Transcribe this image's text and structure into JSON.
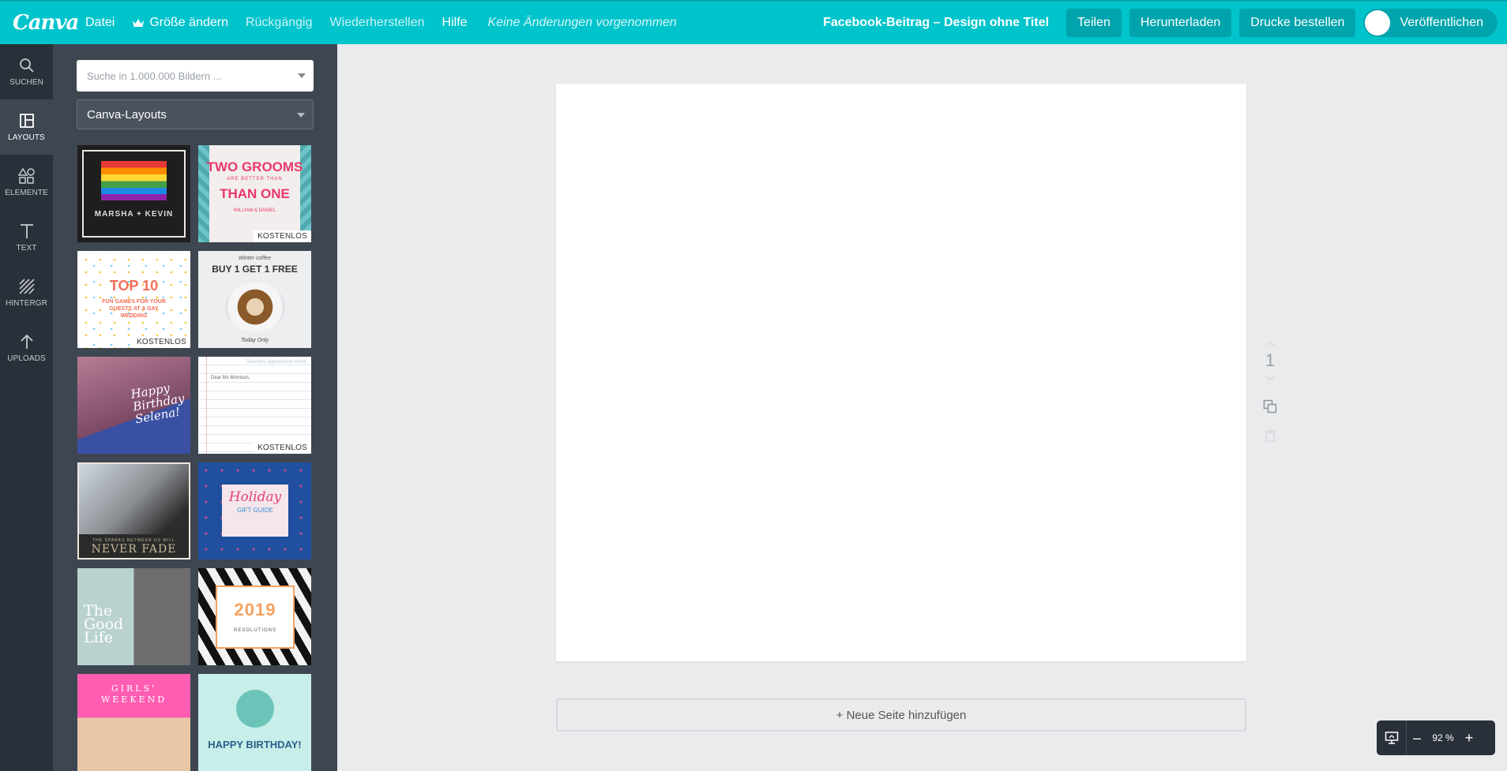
{
  "app": {
    "logo": "Canva"
  },
  "menu": {
    "file": "Datei",
    "resize": "Größe ändern",
    "undo": "Rückgängig",
    "redo": "Wiederherstellen",
    "help": "Hilfe",
    "status": "Keine Änderungen vorgenommen"
  },
  "header": {
    "title": "Facebook-Beitrag – Design ohne Titel",
    "share": "Teilen",
    "download": "Herunterladen",
    "print": "Drucke bestellen",
    "publish": "Veröffentlichen"
  },
  "rail": {
    "items": [
      {
        "label": "SUCHEN",
        "icon": "search-icon"
      },
      {
        "label": "LAYOUTS",
        "icon": "layout-icon"
      },
      {
        "label": "ELEMENTE",
        "icon": "shapes-icon"
      },
      {
        "label": "TEXT",
        "icon": "text-icon"
      },
      {
        "label": "HINTERGR",
        "icon": "background-icon"
      },
      {
        "label": "UPLOADS",
        "icon": "upload-icon"
      }
    ]
  },
  "panel": {
    "search_placeholder": "Suche in 1.000.000 Bildern ...",
    "filter_value": "Canva-Layouts",
    "badge": "KOSTENLOS"
  },
  "thumbs": {
    "t1": {
      "caption": "MARSHA + KEVIN"
    },
    "t2": {
      "line1": "TWO GROOMS",
      "line2": "ARE BETTER THAN",
      "line3": "THAN ONE",
      "line4": "WILLIAM & DANIEL"
    },
    "t3": {
      "line1": "TOP 10",
      "line2": "FUN GAMES FOR YOUR GUESTS AT A GAY WEDDING"
    },
    "t4": {
      "line0": "Winter coffee",
      "line1": "BUY 1 GET 1 FREE",
      "line2": "Today Only"
    },
    "t5": {
      "line1": "Happy",
      "line2": "Birthday",
      "line3": "Selena!"
    },
    "t6": {
      "line1": "Teachers Appreciation Week",
      "line2": "Dear Ms Morrison,"
    },
    "t7": {
      "line1": "THE SPARKS BETWEEN US WILL",
      "line2": "NEVER FADE"
    },
    "t8": {
      "line1": "Holiday",
      "line2": "GIFT GUIDE"
    },
    "t9": {
      "line1": "The",
      "line2": "Good",
      "line3": "Life"
    },
    "t10": {
      "line1": "2019",
      "line2": "RESOLUTIONS"
    },
    "t11": {
      "line1": "GIRLS'",
      "line2": "WEEKEND"
    },
    "t12": {
      "line1": "HAPPY BIRTHDAY!"
    }
  },
  "canvas": {
    "page_number": "1",
    "add_page": "+ Neue Seite hinzufügen"
  },
  "zoom": {
    "minus": "–",
    "value": "92 %",
    "plus": "+"
  },
  "colors": {
    "brand": "#00c4cc",
    "rail": "#293039",
    "panel": "#3e4651"
  }
}
